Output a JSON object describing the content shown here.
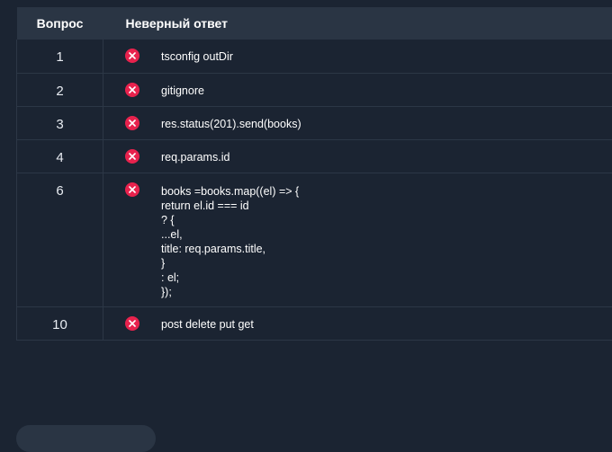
{
  "table": {
    "headers": {
      "question": "Вопрос",
      "wrong_answer": "Неверный ответ"
    },
    "rows": [
      {
        "question": "1",
        "answer": "tsconfig outDir",
        "status_icon": "wrong-icon"
      },
      {
        "question": "2",
        "answer": "gitignore",
        "status_icon": "wrong-icon"
      },
      {
        "question": "3",
        "answer": "res.status(201).send(books)",
        "status_icon": "wrong-icon"
      },
      {
        "question": "4",
        "answer": "req.params.id",
        "status_icon": "wrong-icon"
      },
      {
        "question": "6",
        "answer": "books =books.map((el) => {\nreturn el.id === id\n? {\n...el,\ntitle: req.params.title,\n}\n: el;\n});",
        "status_icon": "wrong-icon"
      },
      {
        "question": "10",
        "answer": "post delete put get",
        "status_icon": "wrong-icon"
      }
    ]
  },
  "colors": {
    "background": "#1b2432",
    "header_background": "#2a3544",
    "wrong_icon": "#e8224d"
  }
}
